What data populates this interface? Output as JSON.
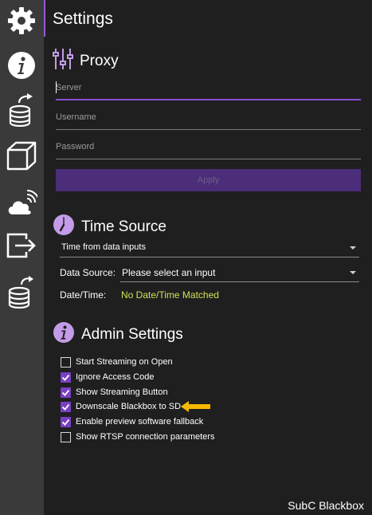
{
  "header": {
    "title": "Settings"
  },
  "sidebar": {
    "icons": [
      "gear-icon",
      "info-icon",
      "database-upload-icon",
      "cube-icon",
      "cloud-signal-icon",
      "export-icon",
      "database-sync-icon"
    ]
  },
  "proxy": {
    "title": "Proxy",
    "server_placeholder": "Server",
    "username_placeholder": "Username",
    "password_placeholder": "Password",
    "apply_label": "Apply"
  },
  "time_source": {
    "title": "Time Source",
    "mode_value": "Time from data inputs",
    "data_source_label": "Data Source:",
    "data_source_value": "Please select an input",
    "datetime_label": "Date/Time:",
    "datetime_value": "No Date/Time Matched"
  },
  "admin": {
    "title": "Admin Settings",
    "options": [
      {
        "label": "Start Streaming on Open",
        "checked": false
      },
      {
        "label": "Ignore Access Code",
        "checked": true
      },
      {
        "label": "Show Streaming Button",
        "checked": true
      },
      {
        "label": "Downscale Blackbox to SD",
        "checked": true
      },
      {
        "label": "Enable preview software fallback",
        "checked": true
      },
      {
        "label": "Show RTSP connection parameters",
        "checked": false
      }
    ]
  },
  "footer": {
    "app_name": "SubC Blackbox"
  },
  "colors": {
    "accent": "#7a3fc4",
    "highlight_text": "#d4e157",
    "arrow": "#f5b800"
  }
}
